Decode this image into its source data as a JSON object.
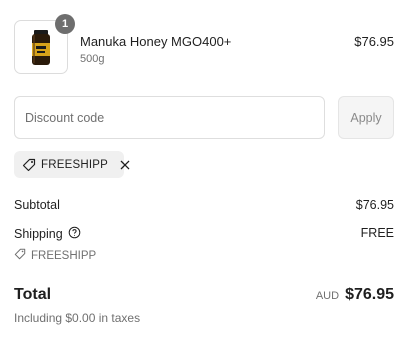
{
  "line_item": {
    "quantity": "1",
    "name": "Manuka Honey MGO400+",
    "variant": "500g",
    "price": "$76.95"
  },
  "discount": {
    "placeholder": "Discount code",
    "value": "",
    "apply_label": "Apply",
    "applied_code": "FREESHIPP"
  },
  "summary": {
    "subtotal_label": "Subtotal",
    "subtotal_value": "$76.95",
    "shipping_label": "Shipping",
    "shipping_value": "FREE",
    "applied_code": "FREESHIPP",
    "total_label": "Total",
    "currency": "AUD",
    "total_value": "$76.95",
    "taxes_note": "Including $0.00 in taxes"
  },
  "icons": {
    "tag": "tag-icon",
    "remove": "close-icon",
    "help": "help-circle-icon"
  },
  "colors": {
    "text": "#1f1f1f",
    "muted": "#707070",
    "badge": "#6e6e6e",
    "tag_bg": "#f0f0f0"
  }
}
